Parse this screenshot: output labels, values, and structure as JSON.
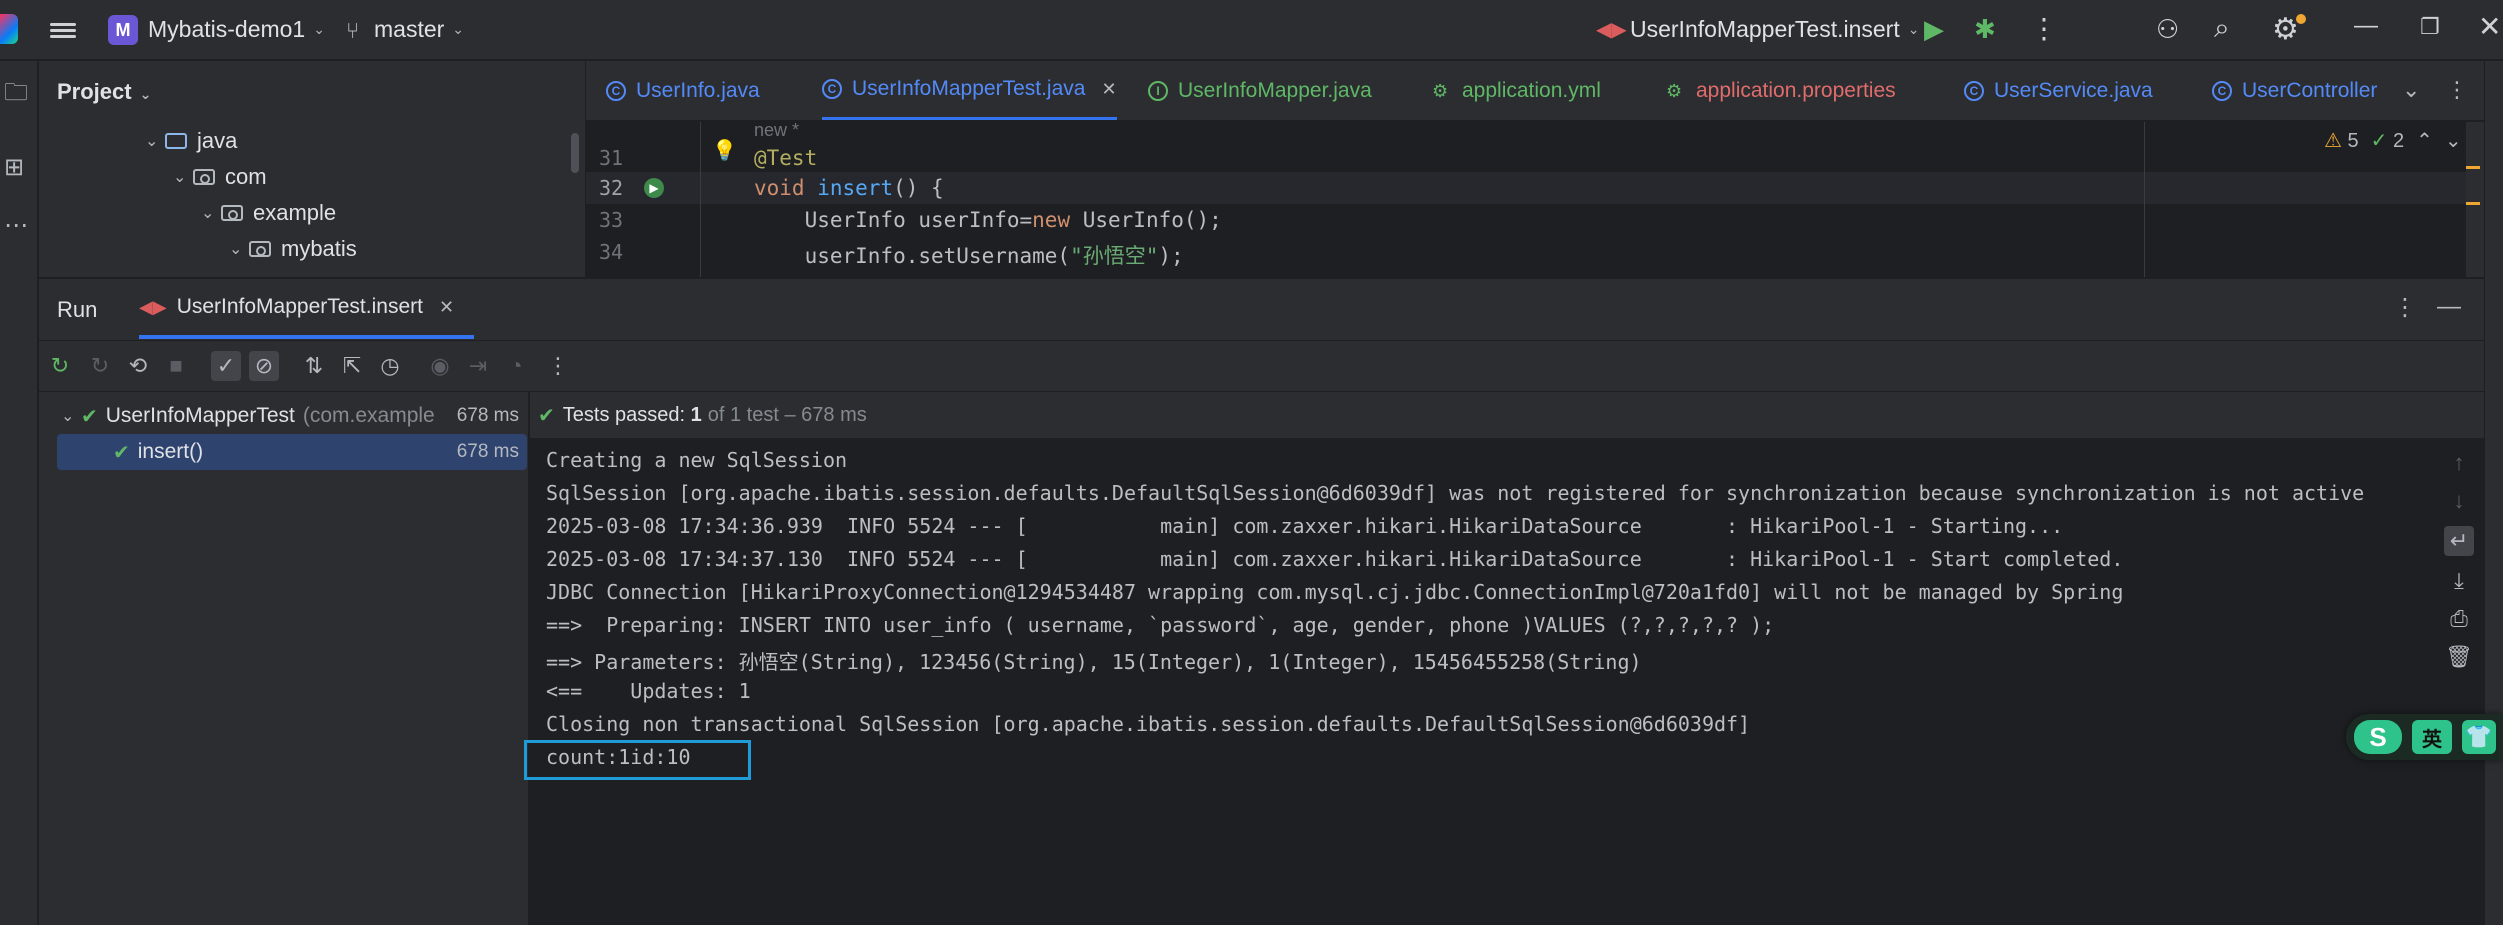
{
  "titlebar": {
    "project_badge": "M",
    "project_name": "Mybatis-demo1",
    "branch": "master",
    "run_config": "UserInfoMapperTest.insert"
  },
  "project_panel": {
    "title": "Project",
    "tree": [
      {
        "label": "java",
        "kind": "folder"
      },
      {
        "label": "com",
        "kind": "package"
      },
      {
        "label": "example",
        "kind": "package"
      },
      {
        "label": "mybatis",
        "kind": "package"
      }
    ]
  },
  "editor_tabs": [
    {
      "label": "UserInfo.java",
      "icon": "class-icon",
      "color": "#548af7"
    },
    {
      "label": "UserInfoMapperTest.java",
      "icon": "class-icon",
      "color": "#548af7",
      "active": true
    },
    {
      "label": "UserInfoMapper.java",
      "icon": "interface-icon",
      "color": "#5fb865"
    },
    {
      "label": "application.yml",
      "icon": "config-icon",
      "color": "#5fb865"
    },
    {
      "label": "application.properties",
      "icon": "config-icon",
      "color": "#e06c6c"
    },
    {
      "label": "UserService.java",
      "icon": "class-icon",
      "color": "#548af7"
    },
    {
      "label": "UserController",
      "icon": "class-icon",
      "color": "#548af7"
    }
  ],
  "editor": {
    "inlay_hint": "new *",
    "lines": [
      {
        "num": "31",
        "code_html": "<span class=\"anno\">@Test</span>"
      },
      {
        "num": "32",
        "code_html": "<span class=\"kw\">void</span> <span class=\"fn\">insert</span>() {"
      },
      {
        "num": "33",
        "code_html": "    UserInfo userInfo=<span class=\"kw\">new</span> UserInfo();"
      },
      {
        "num": "34",
        "code_html": "    userInfo.setUsername(<span class=\"str\">\"孙悟空\"</span>);"
      }
    ],
    "warnings": "5",
    "ok_count": "2"
  },
  "run": {
    "title": "Run",
    "tab_label": "UserInfoMapperTest.insert",
    "tests_passed_label": "Tests passed:",
    "tests_passed_count": "1",
    "tests_passed_detail": "of 1 test – 678 ms",
    "tree": [
      {
        "label": "UserInfoMapperTest",
        "detail": "(com.example",
        "time": "678 ms"
      },
      {
        "label": "insert()",
        "detail": "",
        "time": "678 ms"
      }
    ]
  },
  "console": {
    "lines": [
      "Creating a new SqlSession",
      "SqlSession [org.apache.ibatis.session.defaults.DefaultSqlSession@6d6039df] was not registered for synchronization because synchronization is not active",
      "2025-03-08 17:34:36.939  INFO 5524 --- [           main] com.zaxxer.hikari.HikariDataSource       : HikariPool-1 - Starting...",
      "2025-03-08 17:34:37.130  INFO 5524 --- [           main] com.zaxxer.hikari.HikariDataSource       : HikariPool-1 - Start completed.",
      "JDBC Connection [HikariProxyConnection@1294534487 wrapping com.mysql.cj.jdbc.ConnectionImpl@720a1fd0] will not be managed by Spring",
      "==>  Preparing: INSERT INTO user_info ( username, `password`, age, gender, phone )VALUES (?,?,?,?,? );",
      "==> Parameters: 孙悟空(String), 123456(String), 15(Integer), 1(Integer), 15456455258(String)",
      "<==    Updates: 1",
      "Closing non transactional SqlSession [org.apache.ibatis.session.defaults.DefaultSqlSession@6d6039df]",
      "count:1id:10"
    ]
  },
  "ime": {
    "logo": "S",
    "lang": "英",
    "skin": "👕"
  },
  "colors": {
    "accent": "#3574f0",
    "success": "#5fb865",
    "highlight_box": "#1f9bd8"
  }
}
